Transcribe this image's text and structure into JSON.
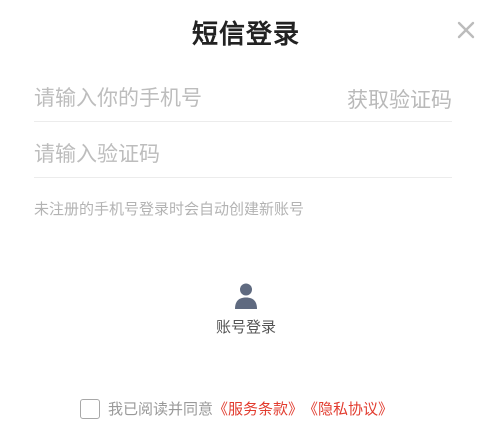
{
  "dialog": {
    "title": "短信登录",
    "close_icon": "close-icon"
  },
  "phone": {
    "placeholder": "请输入你的手机号",
    "get_code_label": "获取验证码"
  },
  "code": {
    "placeholder": "请输入验证码"
  },
  "hint": "未注册的手机号登录时会自动创建新账号",
  "alt_login": {
    "icon": "user-icon",
    "label": "账号登录"
  },
  "agreement": {
    "prefix": "我已阅读并同意",
    "service_link": "《服务条款》",
    "privacy_link": "《隐私协议》",
    "link_color": "#e23c2f"
  }
}
